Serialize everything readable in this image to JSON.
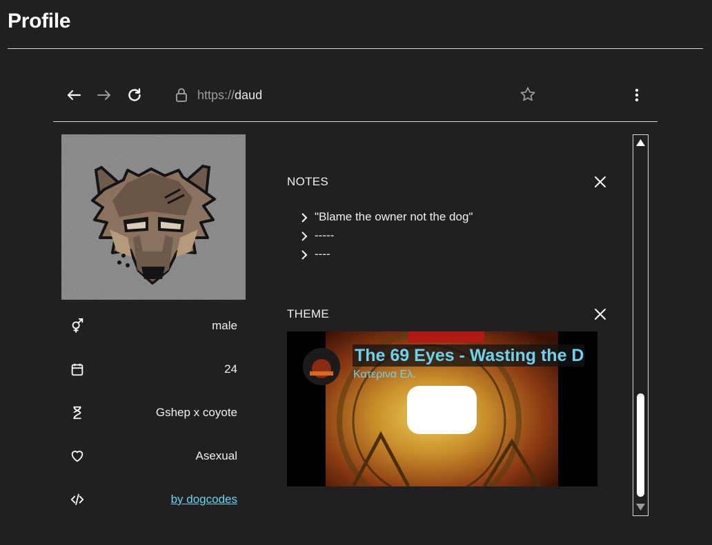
{
  "page": {
    "title": "Profile"
  },
  "browser": {
    "url_scheme": "https://",
    "url_host": "daud",
    "icons": [
      "arrow-left-icon",
      "arrow-right-icon",
      "reload-icon",
      "lock-icon",
      "star-icon",
      "more-vertical-icon"
    ]
  },
  "profile": {
    "avatar_icon": "wolf-pixel-avatar",
    "info": [
      {
        "icon": "gender-icon",
        "value": "male"
      },
      {
        "icon": "calendar-icon",
        "value": "24"
      },
      {
        "icon": "hourglass-icon",
        "value": "Gshep x coyote"
      },
      {
        "icon": "heart-icon",
        "value": "Asexual"
      },
      {
        "icon": "code-icon",
        "value": "by dogcodes"
      }
    ]
  },
  "notes": {
    "title": "NOTES",
    "items": [
      "\"Blame the owner not the dog\"",
      "-----",
      "----"
    ]
  },
  "theme": {
    "title": "THEME",
    "video_title": "The 69 Eyes - Wasting the D",
    "channel": "Κατερινα Ελ."
  },
  "colors": {
    "background": "#202020",
    "text": "#f2f2f2",
    "link": "#6ad4ee",
    "divider": "#d9d9d9"
  }
}
